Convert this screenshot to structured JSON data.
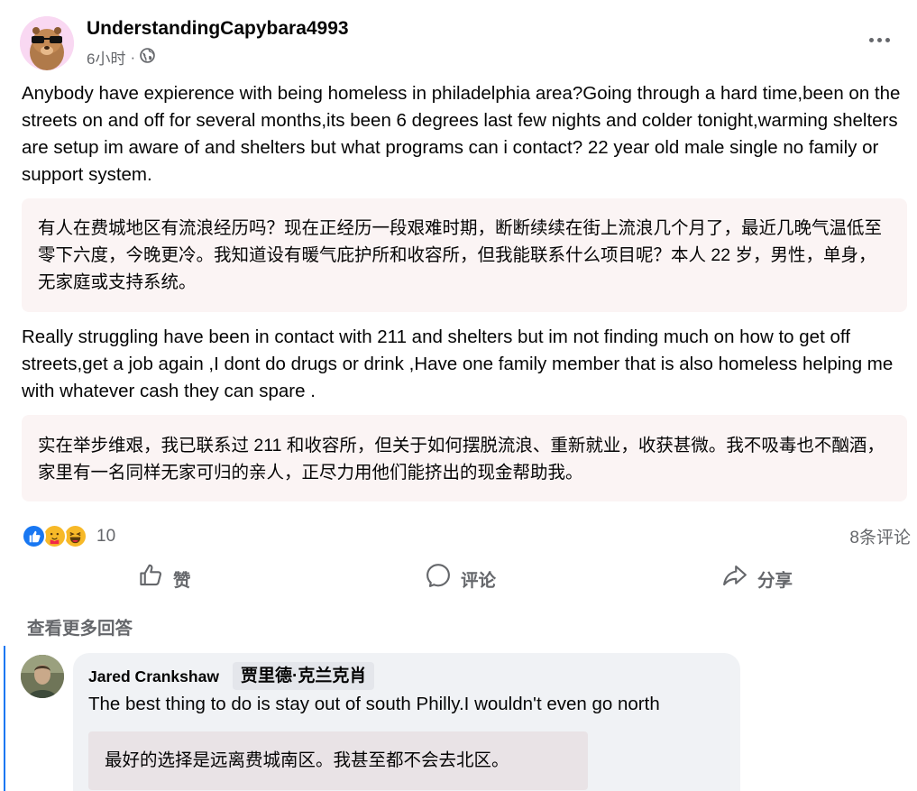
{
  "post": {
    "author": "UnderstandingCapybara4993",
    "time": "6小时",
    "separator": "·",
    "body_1": "Anybody have expierence with being homeless in philadelphia area?Going through a hard time,been on the streets on and off for several months,its been 6 degrees last few nights and colder tonight,warming shelters are setup im aware of and shelters but what programs can i contact? 22 year old male single no family or support system.",
    "translation_1": "有人在费城地区有流浪经历吗？现在正经历一段艰难时期，断断续续在街上流浪几个月了，最近几晚气温低至零下六度，今晚更冷。我知道设有暖气庇护所和收容所，但我能联系什么项目呢？本人 22 岁，男性，单身，无家庭或支持系统。",
    "body_2": "Really struggling have been in contact with 211 and shelters but im not finding much on how to get off streets,get a job again ,I dont do drugs or drink ,Have one family member that is also homeless helping me with whatever cash they can spare .",
    "translation_2": "实在举步维艰，我已联系过 211 和收容所，但关于如何摆脱流浪、重新就业，收获甚微。我不吸毒也不酗酒，家里有一名同样无家可归的亲人，正尽力用他们能挤出的现金帮助我。"
  },
  "stats": {
    "reaction_count": "10",
    "reaction_icons": [
      "like-icon",
      "care-icon",
      "haha-icon"
    ],
    "comment_count": "8条评论"
  },
  "actions": {
    "like": "赞",
    "comment": "评论",
    "share": "分享"
  },
  "more_answers": "查看更多回答",
  "comment": {
    "author": "Jared Crankshaw",
    "author_translation": "贾里德·克兰克肖",
    "text": "The best thing to do is stay out of south Philly.I wouldn't even go north",
    "translation": "最好的选择是远离费城南区。我甚至都不会去北区。"
  },
  "colors": {
    "accent": "#1877f2",
    "secondary_text": "#65676b",
    "translation_bg": "#fbf4f4",
    "bubble_bg": "#f0f2f5"
  }
}
